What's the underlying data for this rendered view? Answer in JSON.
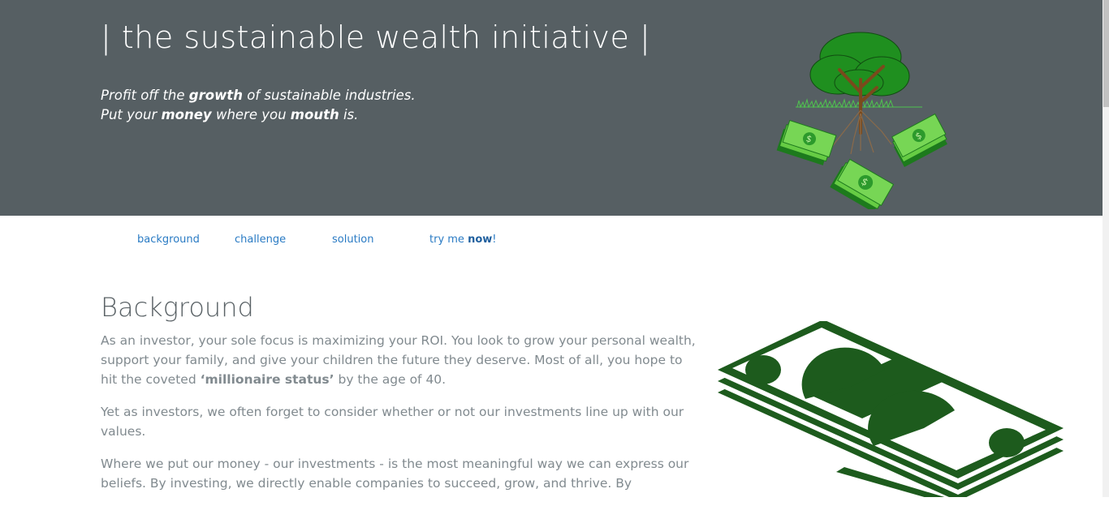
{
  "hero": {
    "title": "| the sustainable wealth initiative |",
    "line1": {
      "a": "Profit off the ",
      "b": "growth",
      "c": " of sustainable industries."
    },
    "line2": {
      "a": "Put your ",
      "b": "money",
      "c": " where you ",
      "d": "mouth",
      "e": " is."
    }
  },
  "nav": {
    "items": [
      "background",
      "challenge",
      "solution"
    ],
    "cta": {
      "a": "try me ",
      "b": "now",
      "c": "!"
    }
  },
  "background": {
    "title": "Background",
    "p1": {
      "a": "As an investor, your sole focus is maximizing your ROI. You look to grow your personal wealth, support your family, and give your children the future they deserve. Most of all, you hope to hit the coveted ",
      "b": "‘millionaire status’",
      "c": " by the age of 40."
    },
    "p2": "Yet as investors, we often forget to consider whether or not our investments line up with our values.",
    "p3": "Where we put our money - our investments - is the most meaningful way we can express our beliefs. By investing, we directly enable companies to succeed, grow, and thrive. By"
  },
  "colors": {
    "hero_bg": "#565f63",
    "link": "#2a7bc4",
    "body_text": "#818a8f",
    "money_dark": "#1d5b1d",
    "money_light": "#44b22a"
  },
  "icons": [
    "tree-money-logo",
    "money-stack-illustration"
  ]
}
